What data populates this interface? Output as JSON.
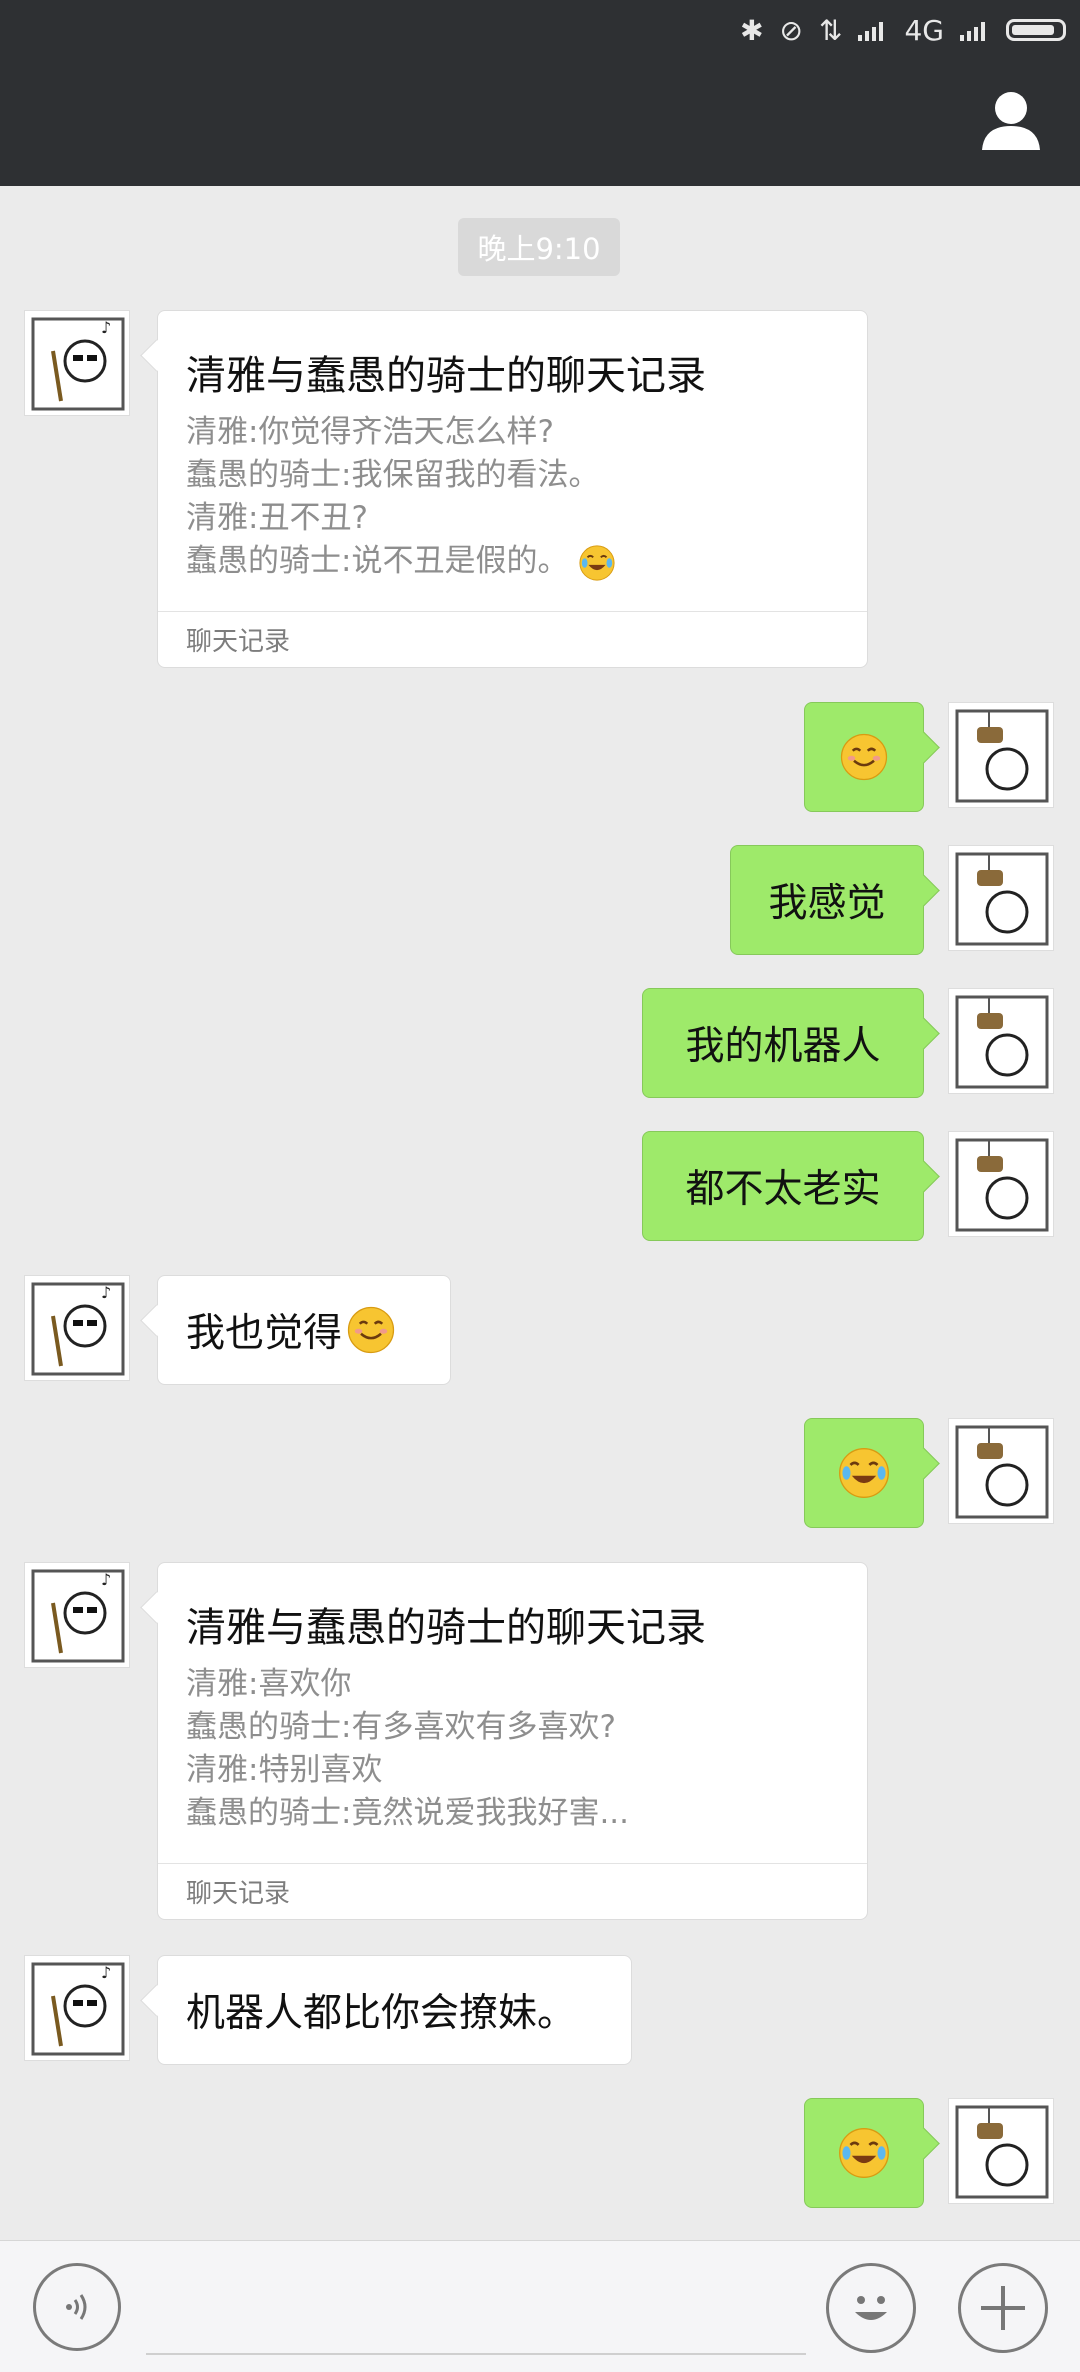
{
  "status_bar": {
    "network": "4G"
  },
  "chat": {
    "timestamp": "晚上9:10",
    "messages": [
      {
        "side": "left",
        "type": "card",
        "title": "清雅与蠢愚的骑士的聊天记录",
        "lines": [
          "清雅:你觉得齐浩天怎么样?",
          "蠢愚的骑士:我保留我的看法。",
          "清雅:丑不丑?",
          "蠢愚的骑士:说不丑是假的。"
        ],
        "footer": "聊天记录"
      },
      {
        "side": "right",
        "type": "emoji",
        "emoji": "smile"
      },
      {
        "side": "right",
        "type": "text",
        "text": "我感觉"
      },
      {
        "side": "right",
        "type": "text",
        "text": "我的机器人"
      },
      {
        "side": "right",
        "type": "text",
        "text": "都不太老实"
      },
      {
        "side": "left",
        "type": "text",
        "text": "我也觉得",
        "emoji": "smile"
      },
      {
        "side": "right",
        "type": "emoji",
        "emoji": "laugh-cry"
      },
      {
        "side": "left",
        "type": "card",
        "title": "清雅与蠢愚的骑士的聊天记录",
        "lines": [
          "清雅:喜欢你",
          "蠢愚的骑士:有多喜欢有多喜欢?",
          "清雅:特别喜欢",
          "蠢愚的骑士:竟然说爱我我好害..."
        ],
        "footer": "聊天记录"
      },
      {
        "side": "left",
        "type": "text",
        "text": "机器人都比你会撩妹。"
      },
      {
        "side": "right",
        "type": "emoji",
        "emoji": "laugh-cry"
      }
    ]
  },
  "colors": {
    "header_bg": "#2e3033",
    "chat_bg": "#ebebeb",
    "sent_bubble": "#9eea6a",
    "received_bubble": "#ffffff"
  },
  "icons": [
    "bluetooth-icon",
    "alarm-off-icon",
    "data-arrows-icon",
    "signal-icon",
    "battery-icon",
    "profile-icon",
    "voice-icon",
    "emoji-icon",
    "add-icon"
  ]
}
